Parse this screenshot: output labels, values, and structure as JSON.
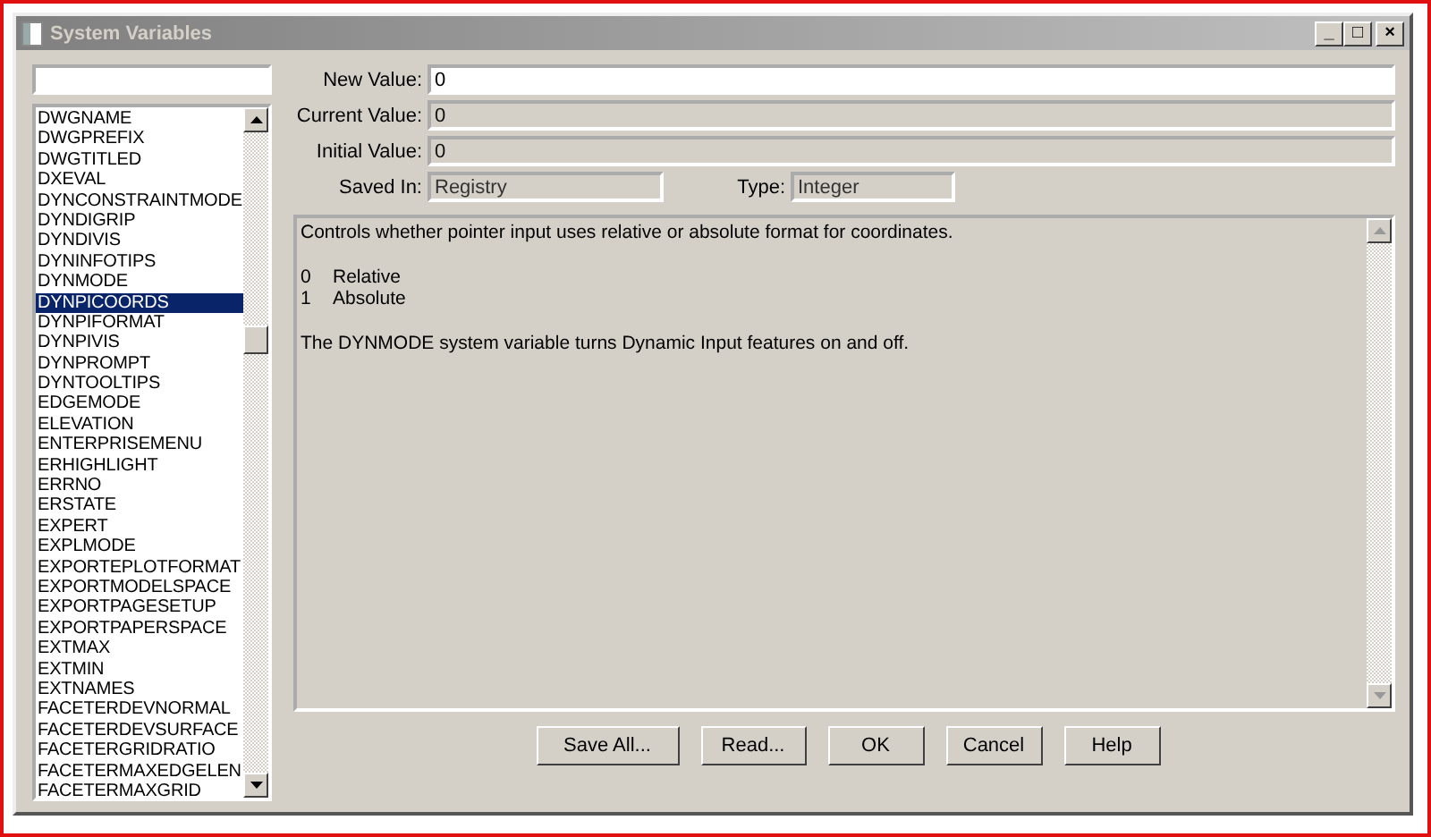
{
  "window": {
    "title": "System Variables",
    "controls": [
      "_",
      "□",
      "×"
    ]
  },
  "search": {
    "kind": "field"
  },
  "variables": [
    {
      "name": "DWGNAME",
      "selected": false
    },
    {
      "name": "DWGPREFIX",
      "selected": false
    },
    {
      "name": "DWGTITLED",
      "selected": false
    },
    {
      "name": "DXEVAL",
      "selected": false
    },
    {
      "name": "DYNCONSTRAINTMODE",
      "selected": false
    },
    {
      "name": "DYNDIGRIP",
      "selected": false
    },
    {
      "name": "DYNDIVIS",
      "selected": false
    },
    {
      "name": "DYNINFOTIPS",
      "selected": false
    },
    {
      "name": "DYNMODE",
      "selected": false
    },
    {
      "name": "DYNPICOORDS",
      "selected": true
    },
    {
      "name": "DYNPIFORMAT",
      "selected": false
    },
    {
      "name": "DYNPIVIS",
      "selected": false
    },
    {
      "name": "DYNPROMPT",
      "selected": false
    },
    {
      "name": "DYNTOOLTIPS",
      "selected": false
    },
    {
      "name": "EDGEMODE",
      "selected": false
    },
    {
      "name": "ELEVATION",
      "selected": false
    },
    {
      "name": "ENTERPRISEMENU",
      "selected": false
    },
    {
      "name": "ERHIGHLIGHT",
      "selected": false
    },
    {
      "name": "ERRNO",
      "selected": false
    },
    {
      "name": "ERSTATE",
      "selected": false
    },
    {
      "name": "EXPERT",
      "selected": false
    },
    {
      "name": "EXPLMODE",
      "selected": false
    },
    {
      "name": "EXPORTEPLOTFORMAT",
      "selected": false
    },
    {
      "name": "EXPORTMODELSPACE",
      "selected": false
    },
    {
      "name": "EXPORTPAGESETUP",
      "selected": false
    },
    {
      "name": "EXPORTPAPERSPACE",
      "selected": false
    },
    {
      "name": "EXTMAX",
      "selected": false
    },
    {
      "name": "EXTMIN",
      "selected": false
    },
    {
      "name": "EXTNAMES",
      "selected": false
    },
    {
      "name": "FACETERDEVNORMAL",
      "selected": false
    },
    {
      "name": "FACETERDEVSURFACE",
      "selected": false
    },
    {
      "name": "FACETERGRIDRATIO",
      "selected": false
    },
    {
      "name": "FACETERMAXEDGELEN",
      "selected": false
    },
    {
      "name": "FACETERMAXGRID",
      "selected": false
    }
  ],
  "fields": [
    {
      "label": "New Value:",
      "value": "0",
      "disabled": false
    },
    {
      "label": "Current Value:",
      "value": "0",
      "disabled": true
    },
    {
      "label": "Initial Value:",
      "value": "0",
      "disabled": true
    }
  ],
  "saved_in": {
    "label": "Saved In:",
    "value": "Registry"
  },
  "type": {
    "label": "Type:",
    "value": "Integer"
  },
  "description": {
    "summary": "Controls whether pointer input uses relative or absolute format for coordinates.",
    "options": [
      {
        "code": "0",
        "meaning": "Relative"
      },
      {
        "code": "1",
        "meaning": "Absolute"
      }
    ],
    "note": "The DYNMODE system variable turns Dynamic Input features on and off."
  },
  "buttons": [
    "Save All...",
    "Read...",
    "OK",
    "Cancel",
    "Help"
  ]
}
